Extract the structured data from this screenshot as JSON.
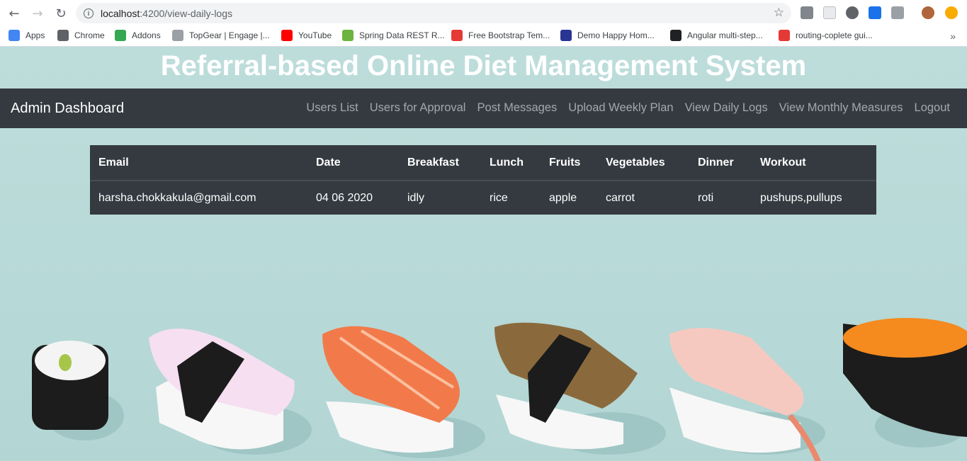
{
  "browser": {
    "url_host": "localhost",
    "url_path": ":4200/view-daily-logs",
    "bookmarks": [
      {
        "label": "Apps",
        "color": "#4285f4"
      },
      {
        "label": "Chrome",
        "color": "#5f6368"
      },
      {
        "label": "Addons",
        "color": "#34a853"
      },
      {
        "label": "TopGear | Engage |...",
        "color": "#9aa0a6"
      },
      {
        "label": "YouTube",
        "color": "#ff0000"
      },
      {
        "label": "Spring Data REST R...",
        "color": "#6db33f"
      },
      {
        "label": "Free Bootstrap Tem...",
        "color": "#e53935"
      },
      {
        "label": "Demo Happy Hom...",
        "color": "#283593"
      },
      {
        "label": "Angular multi-step...",
        "color": "#202124"
      },
      {
        "label": "routing-coplete gui...",
        "color": "#e53935"
      }
    ]
  },
  "site": {
    "title": "Referral-based Online Diet Management System"
  },
  "navbar": {
    "brand": "Admin Dashboard",
    "links": [
      "Users List",
      "Users for Approval",
      "Post Messages",
      "Upload Weekly Plan",
      "View Daily Logs",
      "View Monthly Measures",
      "Logout"
    ]
  },
  "table": {
    "headers": [
      "Email",
      "Date",
      "Breakfast",
      "Lunch",
      "Fruits",
      "Vegetables",
      "Dinner",
      "Workout"
    ],
    "rows": [
      [
        "harsha.chokkakula@gmail.com",
        "04 06 2020",
        "idly",
        "rice",
        "apple",
        "carrot",
        "roti",
        "pushups,pullups"
      ]
    ]
  }
}
